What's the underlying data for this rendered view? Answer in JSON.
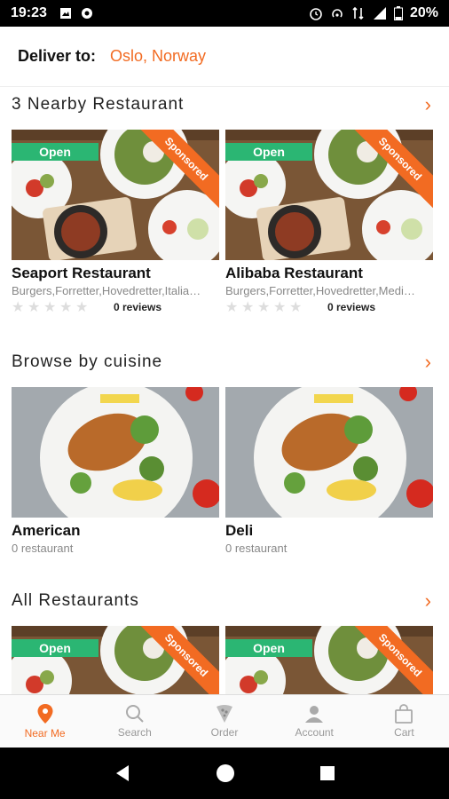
{
  "status_bar": {
    "time": "19:23",
    "battery": "20%"
  },
  "header": {
    "deliver_label": "Deliver to:",
    "location": "Oslo, Norway"
  },
  "sections": {
    "nearby": {
      "title": "3 Nearby Restaurant",
      "cards": [
        {
          "badge": "Open",
          "ribbon": "Sponsored",
          "name": "Seaport Restaurant",
          "tags": "Burgers,Forretter,Hovedretter,Italia…",
          "reviews": "0 reviews",
          "rating": 0
        },
        {
          "badge": "Open",
          "ribbon": "Sponsored",
          "name": "Alibaba Restaurant",
          "tags": "Burgers,Forretter,Hovedretter,Medi…",
          "reviews": "0 reviews",
          "rating": 0
        }
      ]
    },
    "cuisine": {
      "title": "Browse by cuisine",
      "cards": [
        {
          "name": "American",
          "count": "0 restaurant"
        },
        {
          "name": "Deli",
          "count": "0 restaurant"
        }
      ]
    },
    "all": {
      "title": "All Restaurants",
      "cards": [
        {
          "badge": "Open",
          "ribbon": "Sponsored"
        },
        {
          "badge": "Open",
          "ribbon": "Sponsored"
        }
      ]
    }
  },
  "bottom_nav": [
    {
      "label": "Near Me",
      "icon": "location-pin-icon",
      "active": true
    },
    {
      "label": "Search",
      "icon": "search-icon",
      "active": false
    },
    {
      "label": "Order",
      "icon": "pizza-icon",
      "active": false
    },
    {
      "label": "Account",
      "icon": "user-icon",
      "active": false
    },
    {
      "label": "Cart",
      "icon": "bag-icon",
      "active": false
    }
  ],
  "colors": {
    "accent": "#f26b22",
    "open_badge": "#2bb673",
    "status_bar": "#000000"
  }
}
